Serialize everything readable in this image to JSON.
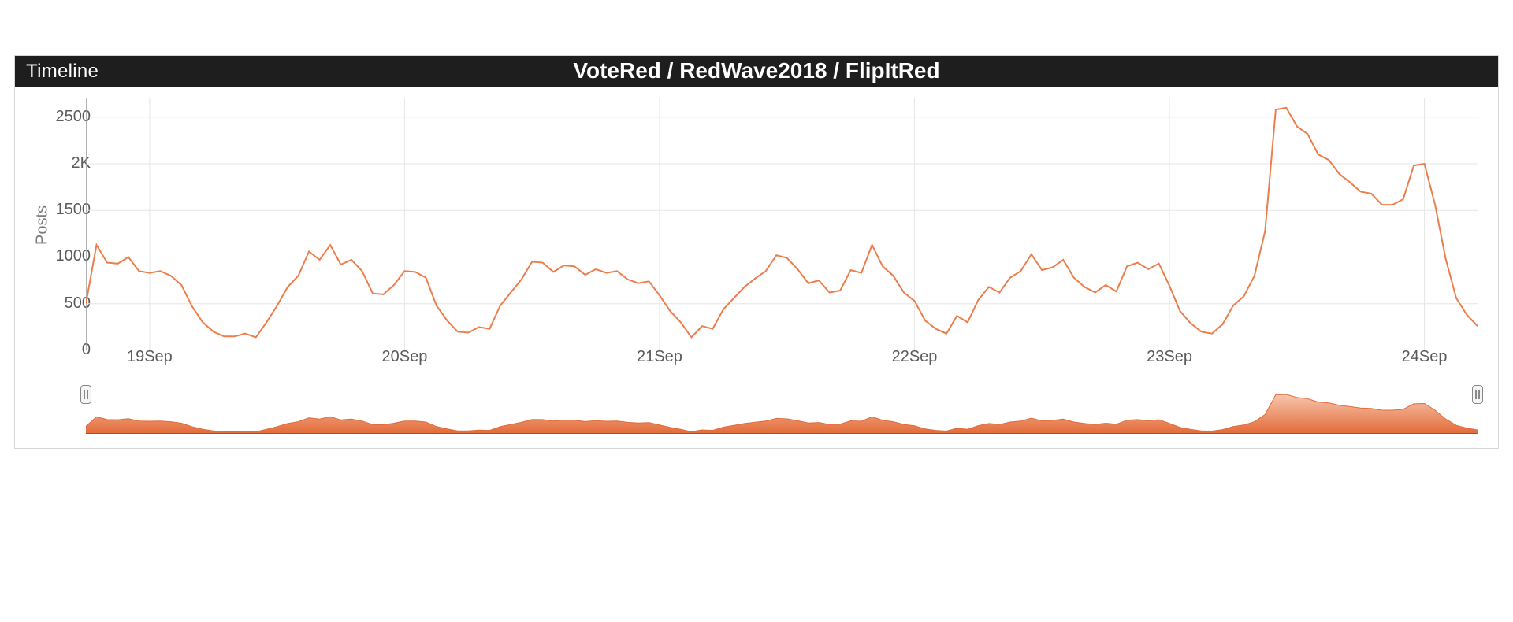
{
  "header": {
    "section_label": "Timeline",
    "title": "VoteRed / RedWave2018 / FlipItRed"
  },
  "axis": {
    "ylabel": "Posts",
    "y_tick_labels": [
      "0",
      "500",
      "1000",
      "1500",
      "2K",
      "2500"
    ],
    "x_tick_labels": [
      "19Sep",
      "20Sep",
      "21Sep",
      "22Sep",
      "23Sep",
      "24Sep"
    ]
  },
  "colors": {
    "line": "#ed7d4b",
    "fill_top": "#f6c6ad",
    "fill_bottom": "#e36a38",
    "header_bg": "#1e1e1e"
  },
  "chart_data": {
    "type": "line",
    "title": "VoteRed / RedWave2018 / FlipItRed",
    "xlabel": "",
    "ylabel": "Posts",
    "ylim": [
      0,
      2700
    ],
    "x": [
      "18Sep 18:00",
      "18Sep 19:00",
      "18Sep 20:00",
      "18Sep 21:00",
      "18Sep 22:00",
      "18Sep 23:00",
      "19Sep 00:00",
      "19Sep 01:00",
      "19Sep 02:00",
      "19Sep 03:00",
      "19Sep 04:00",
      "19Sep 05:00",
      "19Sep 06:00",
      "19Sep 07:00",
      "19Sep 08:00",
      "19Sep 09:00",
      "19Sep 10:00",
      "19Sep 11:00",
      "19Sep 12:00",
      "19Sep 13:00",
      "19Sep 14:00",
      "19Sep 15:00",
      "19Sep 16:00",
      "19Sep 17:00",
      "19Sep 18:00",
      "19Sep 19:00",
      "19Sep 20:00",
      "19Sep 21:00",
      "19Sep 22:00",
      "19Sep 23:00",
      "20Sep 00:00",
      "20Sep 01:00",
      "20Sep 02:00",
      "20Sep 03:00",
      "20Sep 04:00",
      "20Sep 05:00",
      "20Sep 06:00",
      "20Sep 07:00",
      "20Sep 08:00",
      "20Sep 09:00",
      "20Sep 10:00",
      "20Sep 11:00",
      "20Sep 12:00",
      "20Sep 13:00",
      "20Sep 14:00",
      "20Sep 15:00",
      "20Sep 16:00",
      "20Sep 17:00",
      "20Sep 18:00",
      "20Sep 19:00",
      "20Sep 20:00",
      "20Sep 21:00",
      "20Sep 22:00",
      "20Sep 23:00",
      "21Sep 00:00",
      "21Sep 01:00",
      "21Sep 02:00",
      "21Sep 03:00",
      "21Sep 04:00",
      "21Sep 05:00",
      "21Sep 06:00",
      "21Sep 07:00",
      "21Sep 08:00",
      "21Sep 09:00",
      "21Sep 10:00",
      "21Sep 11:00",
      "21Sep 12:00",
      "21Sep 13:00",
      "21Sep 14:00",
      "21Sep 15:00",
      "21Sep 16:00",
      "21Sep 17:00",
      "21Sep 18:00",
      "21Sep 19:00",
      "21Sep 20:00",
      "21Sep 21:00",
      "21Sep 22:00",
      "21Sep 23:00",
      "22Sep 00:00",
      "22Sep 01:00",
      "22Sep 02:00",
      "22Sep 03:00",
      "22Sep 04:00",
      "22Sep 05:00",
      "22Sep 06:00",
      "22Sep 07:00",
      "22Sep 08:00",
      "22Sep 09:00",
      "22Sep 10:00",
      "22Sep 11:00",
      "22Sep 12:00",
      "22Sep 13:00",
      "22Sep 14:00",
      "22Sep 15:00",
      "22Sep 16:00",
      "22Sep 17:00",
      "22Sep 18:00",
      "22Sep 19:00",
      "22Sep 20:00",
      "22Sep 21:00",
      "22Sep 22:00",
      "22Sep 23:00",
      "23Sep 00:00",
      "23Sep 01:00",
      "23Sep 02:00",
      "23Sep 03:00",
      "23Sep 04:00",
      "23Sep 05:00",
      "23Sep 06:00",
      "23Sep 07:00",
      "23Sep 08:00",
      "23Sep 09:00",
      "23Sep 10:00",
      "23Sep 11:00",
      "23Sep 12:00",
      "23Sep 13:00",
      "23Sep 14:00",
      "23Sep 15:00",
      "23Sep 16:00",
      "23Sep 17:00",
      "23Sep 18:00",
      "23Sep 19:00",
      "23Sep 20:00",
      "23Sep 21:00",
      "23Sep 22:00",
      "23Sep 23:00",
      "24Sep 00:00",
      "24Sep 01:00",
      "24Sep 02:00",
      "24Sep 03:00",
      "24Sep 04:00",
      "24Sep 05:00"
    ],
    "values": [
      500,
      1130,
      940,
      930,
      1000,
      850,
      830,
      850,
      800,
      700,
      470,
      300,
      200,
      150,
      150,
      180,
      140,
      300,
      480,
      680,
      800,
      1060,
      970,
      1130,
      920,
      970,
      850,
      610,
      600,
      700,
      850,
      840,
      780,
      480,
      320,
      200,
      190,
      250,
      230,
      480,
      620,
      760,
      950,
      940,
      840,
      910,
      900,
      810,
      870,
      830,
      850,
      760,
      720,
      740,
      590,
      420,
      300,
      140,
      260,
      230,
      440,
      560,
      680,
      770,
      850,
      1020,
      990,
      870,
      720,
      750,
      620,
      640,
      860,
      830,
      1130,
      900,
      800,
      620,
      530,
      320,
      230,
      180,
      370,
      300,
      540,
      680,
      620,
      780,
      850,
      1030,
      860,
      890,
      970,
      780,
      680,
      620,
      700,
      630,
      900,
      940,
      870,
      930,
      690,
      420,
      290,
      200,
      180,
      280,
      480,
      580,
      800,
      1280,
      2580,
      2600,
      2400,
      2320,
      2100,
      2040,
      1890,
      1800,
      1700,
      1680,
      1560,
      1560,
      1620,
      1980,
      2000,
      1560,
      980,
      560,
      380,
      260
    ],
    "x_ticks": [
      "19Sep",
      "20Sep",
      "21Sep",
      "22Sep",
      "23Sep",
      "24Sep"
    ],
    "grid": true,
    "legend": false
  }
}
